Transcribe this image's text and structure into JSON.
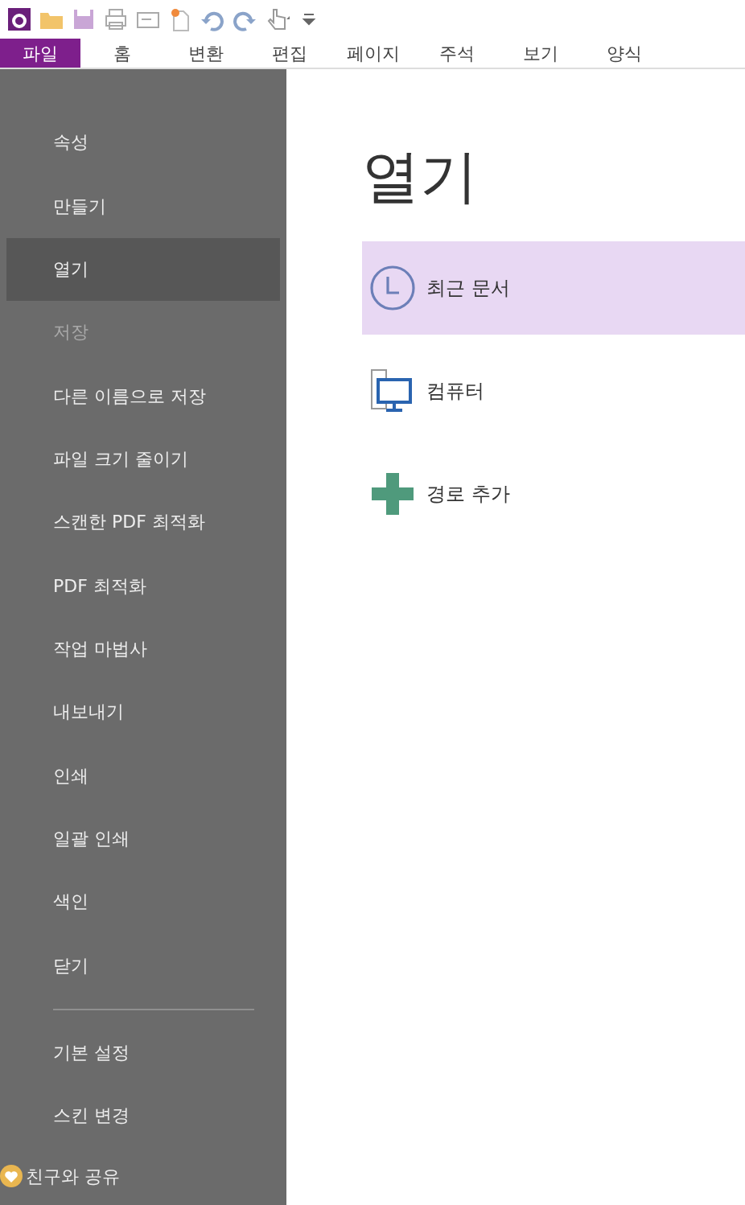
{
  "quick_access": [
    {
      "kind": "logo"
    },
    {
      "kind": "folder"
    },
    {
      "kind": "save"
    },
    {
      "kind": "print"
    },
    {
      "kind": "mail"
    },
    {
      "kind": "new"
    },
    {
      "kind": "undo"
    },
    {
      "kind": "redo"
    },
    {
      "kind": "hand"
    },
    {
      "kind": "customize"
    }
  ],
  "tabs": [
    {
      "label": "파일",
      "selected": true
    },
    {
      "label": "홈",
      "selected": false
    },
    {
      "label": "변환",
      "selected": false
    },
    {
      "label": "편집",
      "selected": false
    },
    {
      "label": "페이지",
      "selected": false
    },
    {
      "label": "주석",
      "selected": false
    },
    {
      "label": "보기",
      "selected": false
    },
    {
      "label": "양식",
      "selected": false
    }
  ],
  "sidebar": {
    "items": [
      {
        "label": "속성",
        "selected": false,
        "disabled": false
      },
      {
        "label": "만들기",
        "selected": false,
        "disabled": false
      },
      {
        "label": "열기",
        "selected": true,
        "disabled": false
      },
      {
        "label": "저장",
        "selected": false,
        "disabled": true
      },
      {
        "label": "다른 이름으로 저장",
        "selected": false,
        "disabled": false
      },
      {
        "label": "파일 크기 줄이기",
        "selected": false,
        "disabled": false
      },
      {
        "label": "스캔한 PDF 최적화",
        "selected": false,
        "disabled": false
      },
      {
        "label": "PDF 최적화",
        "selected": false,
        "disabled": false
      },
      {
        "label": "작업 마법사",
        "selected": false,
        "disabled": false
      },
      {
        "label": "내보내기",
        "selected": false,
        "disabled": false
      },
      {
        "label": "인쇄",
        "selected": false,
        "disabled": false
      },
      {
        "label": "일괄 인쇄",
        "selected": false,
        "disabled": false
      },
      {
        "label": "색인",
        "selected": false,
        "disabled": false
      },
      {
        "label": "닫기",
        "selected": false,
        "disabled": false
      }
    ],
    "bottom_items": [
      {
        "label": "기본 설정",
        "kind": "plain"
      },
      {
        "label": "스킨 변경",
        "kind": "plain"
      },
      {
        "label": "친구와 공유",
        "kind": "share"
      }
    ]
  },
  "main": {
    "title": "열기",
    "options": [
      {
        "label": "최근 문서",
        "kind": "recent",
        "selected": true
      },
      {
        "label": "컴퓨터",
        "kind": "computer",
        "selected": false
      },
      {
        "label": "경로 추가",
        "kind": "add",
        "selected": false
      }
    ]
  }
}
